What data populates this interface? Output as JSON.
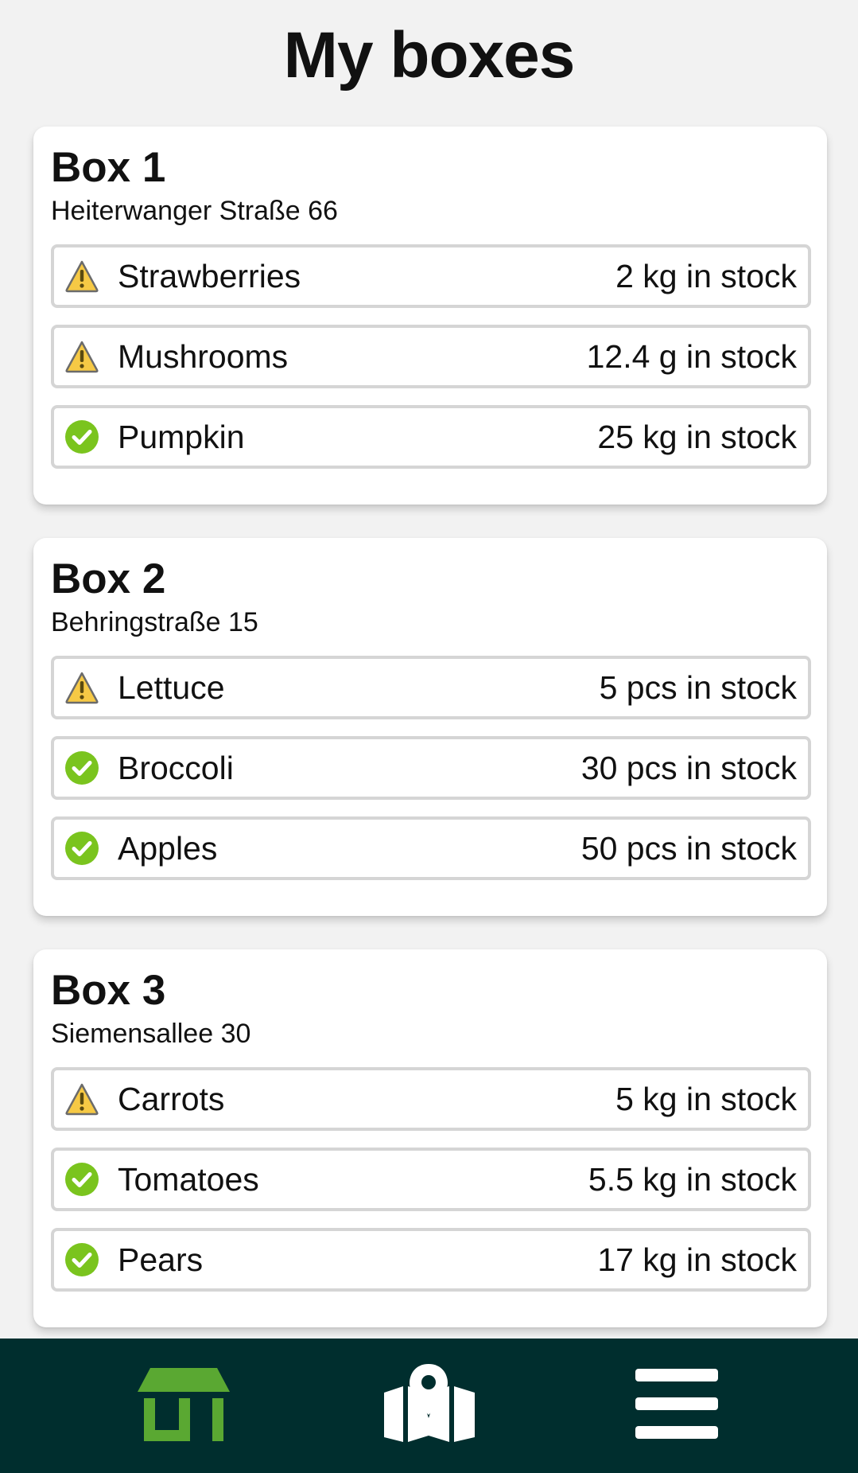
{
  "page": {
    "title": "My boxes"
  },
  "colors": {
    "ok": "#7ac41e",
    "warning": "#f6c945",
    "nav_background": "#002e2e",
    "nav_active": "#5aa832",
    "nav_inactive": "#ffffff"
  },
  "boxes": [
    {
      "title": "Box 1",
      "address": "Heiterwanger Straße 66",
      "items": [
        {
          "name": "Strawberries",
          "stock": "2 kg in stock",
          "status": "warning",
          "icon": "warning-icon"
        },
        {
          "name": "Mushrooms",
          "stock": "12.4 g in stock",
          "status": "warning",
          "icon": "warning-icon"
        },
        {
          "name": "Pumpkin",
          "stock": "25 kg in stock",
          "status": "ok",
          "icon": "check-circle-icon"
        }
      ]
    },
    {
      "title": "Box 2",
      "address": "Behringstraße 15",
      "items": [
        {
          "name": "Lettuce",
          "stock": "5 pcs in stock",
          "status": "warning",
          "icon": "warning-icon"
        },
        {
          "name": "Broccoli",
          "stock": "30 pcs in stock",
          "status": "ok",
          "icon": "check-circle-icon"
        },
        {
          "name": "Apples",
          "stock": "50 pcs in stock",
          "status": "ok",
          "icon": "check-circle-icon"
        }
      ]
    },
    {
      "title": "Box 3",
      "address": "Siemensallee 30",
      "items": [
        {
          "name": "Carrots",
          "stock": "5 kg in stock",
          "status": "warning",
          "icon": "warning-icon"
        },
        {
          "name": "Tomatoes",
          "stock": "5.5 kg in stock",
          "status": "ok",
          "icon": "check-circle-icon"
        },
        {
          "name": "Pears",
          "stock": "17 kg in stock",
          "status": "ok",
          "icon": "check-circle-icon"
        }
      ]
    }
  ],
  "bottom_nav": {
    "items": [
      {
        "icon": "store-icon",
        "active": true
      },
      {
        "icon": "map-pin-icon",
        "active": false
      },
      {
        "icon": "menu-icon",
        "active": false
      }
    ]
  }
}
